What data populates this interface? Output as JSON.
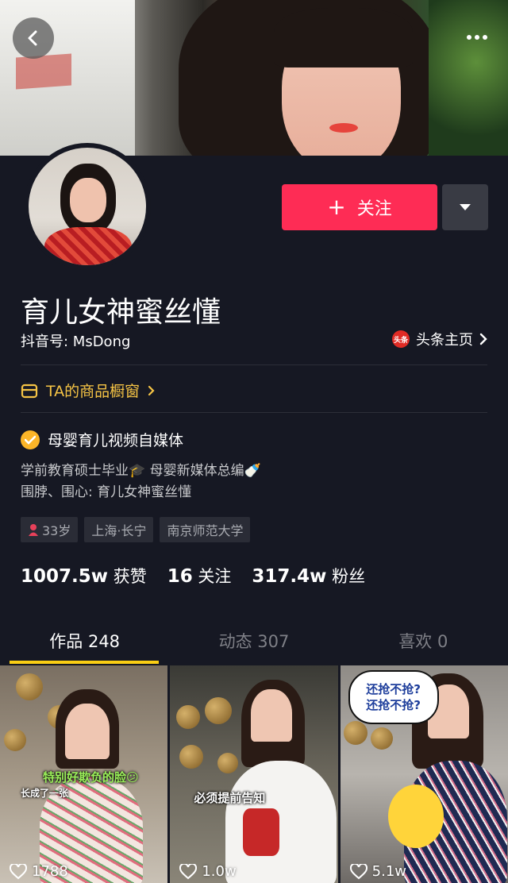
{
  "header": {
    "back_icon": "chevron-left-icon",
    "more_icon": "more-dots-icon"
  },
  "profile": {
    "nickname": "育儿女神蜜丝懂",
    "douyin_id": "抖音号: MsDong",
    "toutiao_logo_text": "头条",
    "toutiao_link": "头条主页",
    "follow_label": "关注",
    "shop_label": "TA的商品橱窗",
    "verified_label": "母婴育儿视频自媒体",
    "bio_line1": "学前教育硕士毕业🎓 母婴新媒体总编🍼",
    "bio_line2": "围脖、围心: 育儿女神蜜丝懂",
    "tags": [
      {
        "label": "33岁",
        "icon": "female-icon"
      },
      {
        "label": "上海·长宁"
      },
      {
        "label": "南京师范大学"
      }
    ]
  },
  "stats": [
    {
      "value": "1007.5w",
      "label": "获赞"
    },
    {
      "value": "16",
      "label": "关注"
    },
    {
      "value": "317.4w",
      "label": "粉丝"
    }
  ],
  "tabs": [
    {
      "label": "作品 248",
      "active": true
    },
    {
      "label": "动态 307",
      "active": false
    },
    {
      "label": "喜欢 0",
      "active": false
    }
  ],
  "videos": [
    {
      "likes": "1788",
      "caption_main": "特别好欺负的脸😕",
      "caption_sub": "长成了一张"
    },
    {
      "likes": "1.0w",
      "caption_main": "必须提前告知"
    },
    {
      "likes": "5.1w",
      "bubble_line1": "还抢不抢?",
      "bubble_line2": "还抢不抢?"
    }
  ],
  "colors": {
    "accent": "#fe2c55",
    "background": "#161823",
    "shop": "#f6c445",
    "tab_indicator": "#face15"
  }
}
